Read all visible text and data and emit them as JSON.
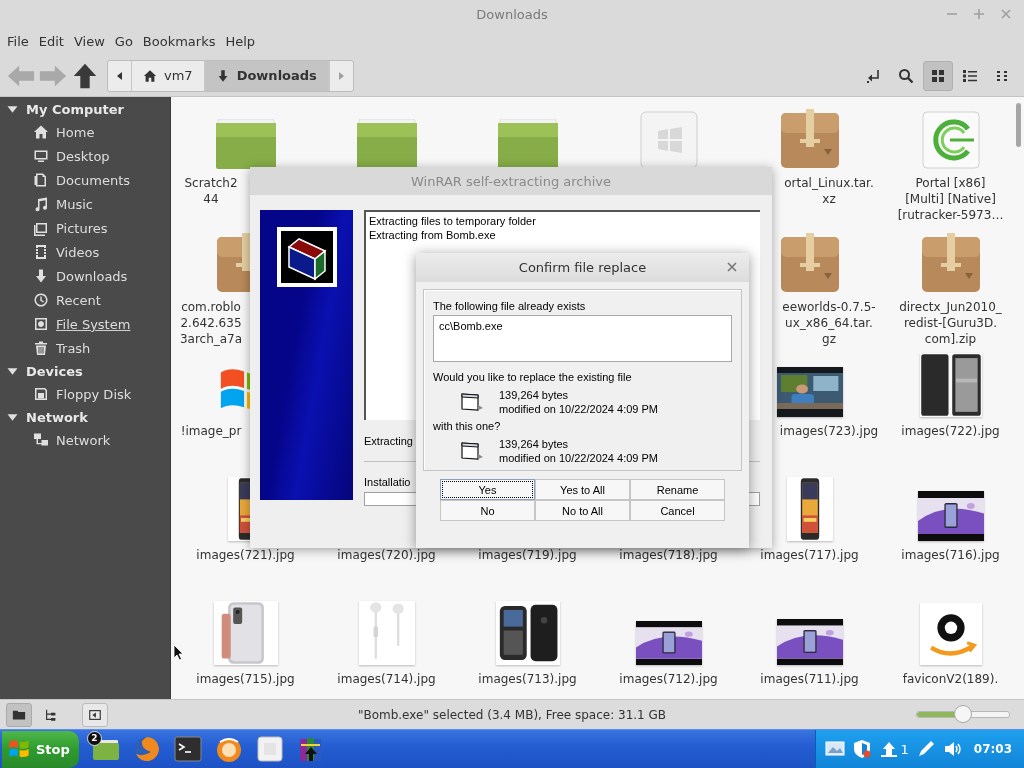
{
  "window": {
    "title": "Downloads"
  },
  "menu": [
    "File",
    "Edit",
    "View",
    "Go",
    "Bookmarks",
    "Help"
  ],
  "toolbar": {
    "nav": [
      {
        "kind": "back",
        "disabled": true
      },
      {
        "kind": "forward",
        "disabled": true
      },
      {
        "kind": "up",
        "disabled": false
      }
    ],
    "path": [
      {
        "kind": "home",
        "label": "vm7",
        "selected": false
      },
      {
        "kind": "downloads",
        "label": "Downloads",
        "selected": true
      }
    ],
    "views": [
      {
        "kind": "icons",
        "selected": true
      },
      {
        "kind": "list",
        "selected": false
      },
      {
        "kind": "compact",
        "selected": false
      }
    ]
  },
  "sidebar": {
    "sections": [
      {
        "title": "My Computer",
        "expanded": true,
        "items": [
          {
            "kind": "home",
            "label": "Home",
            "hovered": false
          },
          {
            "kind": "desktop",
            "label": "Desktop",
            "hovered": false
          },
          {
            "kind": "documents",
            "label": "Documents",
            "hovered": false
          },
          {
            "kind": "music",
            "label": "Music",
            "hovered": false
          },
          {
            "kind": "pictures",
            "label": "Pictures",
            "hovered": false
          },
          {
            "kind": "videos",
            "label": "Videos",
            "hovered": false
          },
          {
            "kind": "downloads",
            "label": "Downloads",
            "hovered": false
          },
          {
            "kind": "recent",
            "label": "Recent",
            "hovered": false
          },
          {
            "kind": "filesystem",
            "label": "File System",
            "hovered": true
          },
          {
            "kind": "trash",
            "label": "Trash",
            "hovered": false
          }
        ]
      },
      {
        "title": "Devices",
        "expanded": true,
        "items": [
          {
            "kind": "floppy",
            "label": "Floppy Disk",
            "hovered": false
          }
        ]
      },
      {
        "title": "Network",
        "expanded": true,
        "items": [
          {
            "kind": "network",
            "label": "Network",
            "hovered": false
          }
        ]
      }
    ]
  },
  "files": [
    {
      "kind": "folder",
      "label": "Scratch2\n44"
    },
    {
      "kind": "folder"
    },
    {
      "kind": "folder"
    },
    {
      "kind": "tile"
    },
    {
      "kind": "package",
      "label": "ortal_Linux.tar.\nxz"
    },
    {
      "kind": "torrent",
      "label": "Portal [x86]\n[Multi] [Native]\n[rutracker-5973…"
    },
    {
      "kind": "package",
      "label": "com.roblo\n2.642.635\n3arch_a7a"
    },
    {
      "kind": "covered"
    },
    {
      "kind": "covered"
    },
    {
      "kind": "covered"
    },
    {
      "kind": "package",
      "label": "eeworlds-0.7.5-\nux_x86_64.tar.\ngz"
    },
    {
      "kind": "package",
      "label": "directx_Jun2010_\nredist-[Guru3D.\ncom].zip"
    },
    {
      "kind": "flag",
      "label": "!image_pr"
    },
    {
      "kind": "covered"
    },
    {
      "kind": "covered"
    },
    {
      "kind": "covered"
    },
    {
      "kind": "picture",
      "label": "images(723).jpg"
    },
    {
      "kind": "picture",
      "label": "images(722).jpg"
    },
    {
      "kind": "picture",
      "label": "images(721).jpg"
    },
    {
      "kind": "covered",
      "label": "images(720).jpg"
    },
    {
      "kind": "covered",
      "label": "images(719).jpg"
    },
    {
      "kind": "covered",
      "label": "images(718).jpg"
    },
    {
      "kind": "picture",
      "label": "images(717).jpg"
    },
    {
      "kind": "picture",
      "label": "images(716).jpg"
    },
    {
      "kind": "picture",
      "label": "images(715).jpg"
    },
    {
      "kind": "picture",
      "label": "images(714).jpg"
    },
    {
      "kind": "picture",
      "label": "images(713).jpg"
    },
    {
      "kind": "picture",
      "label": "images(712).jpg"
    },
    {
      "kind": "picture",
      "label": "images(711).jpg"
    },
    {
      "kind": "picture",
      "label": "faviconV2(189)."
    }
  ],
  "archive_dialog": {
    "title": "WinRAR self-extracting archive",
    "log": [
      "Extracting files to temporary folder",
      "Extracting from Bomb.exe"
    ],
    "status": "Extracting",
    "progress": {
      "label": "Installatio"
    }
  },
  "confirm_dialog": {
    "title": "Confirm file replace",
    "message": "The following file already exists",
    "path": "cc\\Bomb.exe",
    "question": "Would you like to replace the existing file",
    "existing": {
      "size": "139,264 bytes",
      "modified": "modified on 10/22/2024 4:09 PM"
    },
    "connector": "with this one?",
    "incoming": {
      "size": "139,264 bytes",
      "modified": "modified on 10/22/2024 4:09 PM"
    },
    "buttons": [
      {
        "label": "Yes",
        "focused": true
      },
      {
        "label": "Yes to All",
        "focused": false
      },
      {
        "label": "Rename",
        "focused": false
      },
      {
        "label": "No",
        "focused": false
      },
      {
        "label": "No to All",
        "focused": false
      },
      {
        "label": "Cancel",
        "focused": false
      }
    ]
  },
  "status_bar": {
    "panes": [
      {
        "kind": "places",
        "selected": true
      },
      {
        "kind": "tree",
        "selected": false
      }
    ],
    "text": "\"Bomb.exe\" selected (3.4 MB), Free space: 31.1 GB",
    "zoom": {
      "level": 0.5
    }
  },
  "taskbar": {
    "start": {
      "label": "Stop"
    },
    "apps": [
      {
        "kind": "files",
        "badge": "2"
      },
      {
        "kind": "browser"
      },
      {
        "kind": "terminal"
      },
      {
        "kind": "orange"
      },
      {
        "kind": "blank"
      },
      {
        "kind": "archiver"
      }
    ],
    "tray": [
      {
        "kind": "display"
      },
      {
        "kind": "shield"
      },
      {
        "kind": "updates",
        "count": "1"
      },
      {
        "kind": "pen"
      },
      {
        "kind": "volume"
      }
    ],
    "clock": "07:03"
  }
}
